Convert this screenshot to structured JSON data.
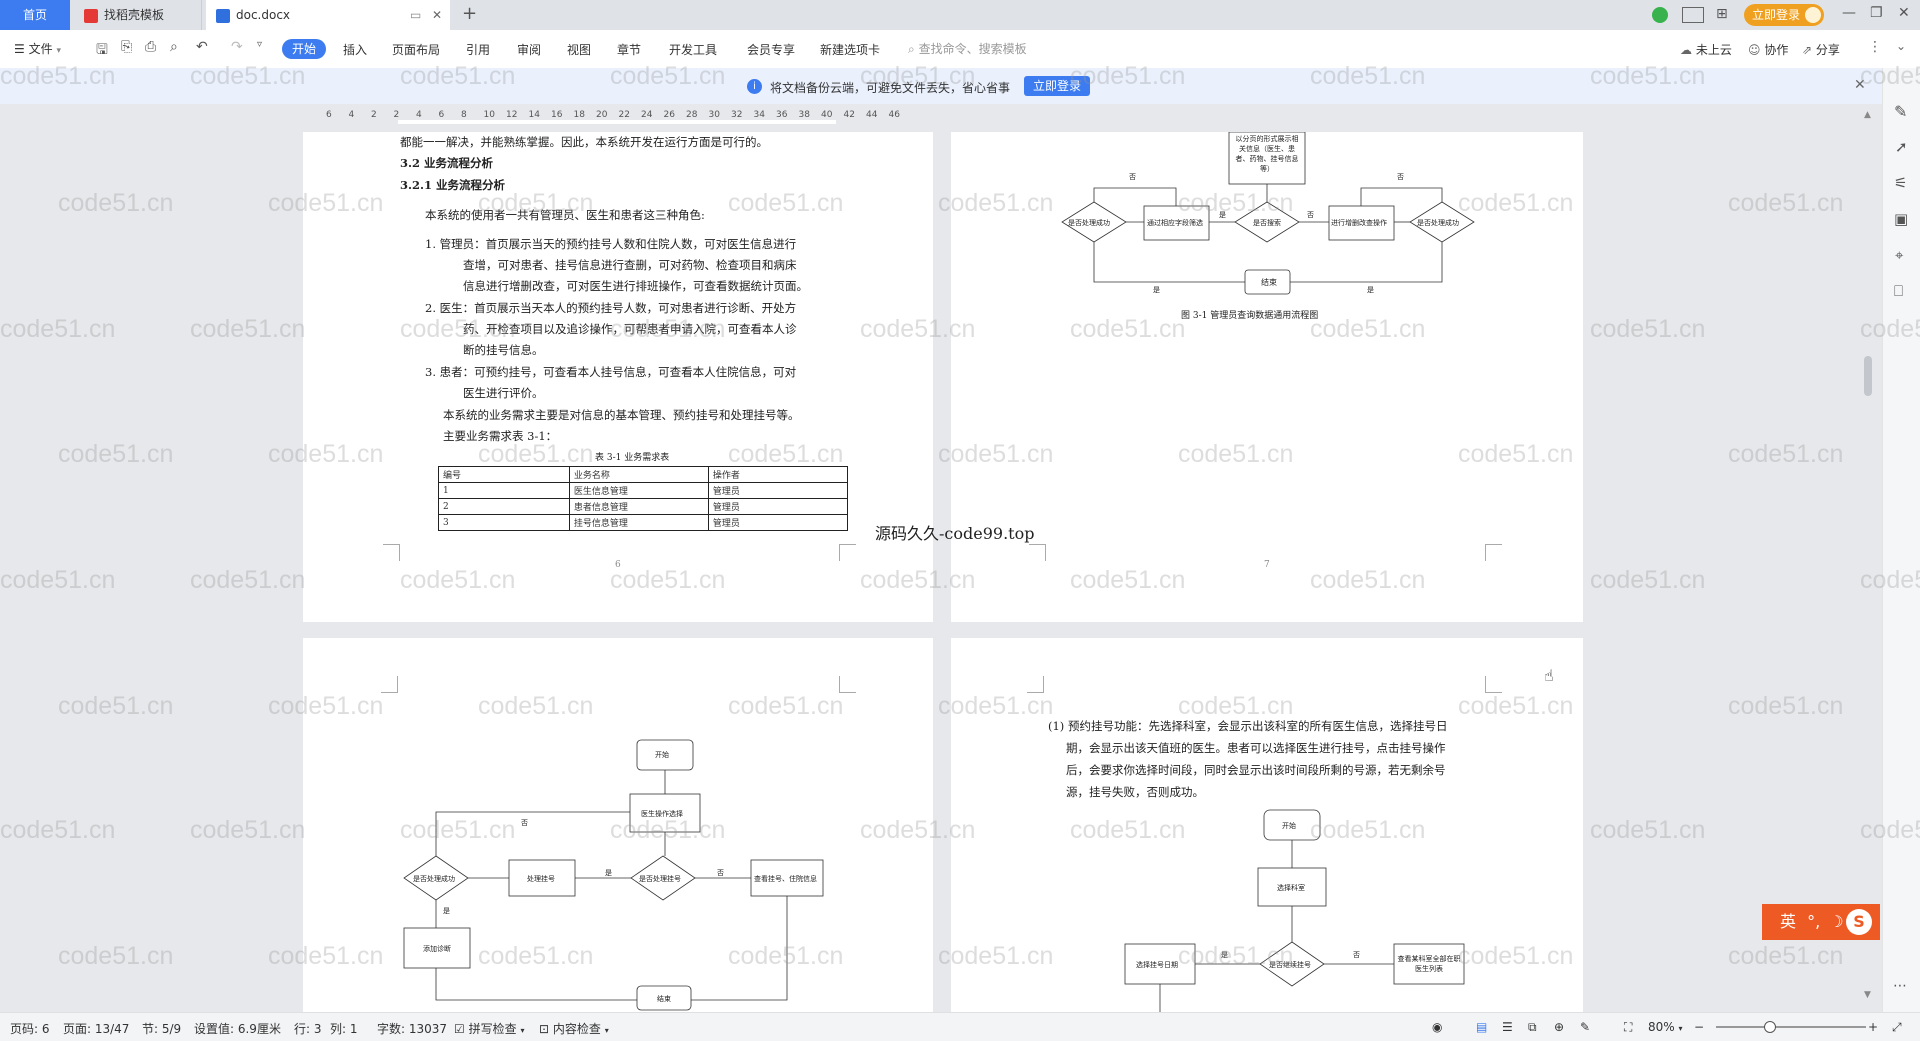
{
  "tabs": {
    "home": "首页",
    "template": "找稻壳模板",
    "doc": "doc.docx",
    "login": "立即登录"
  },
  "toolbar": {
    "file": "文件",
    "menus": [
      "开始",
      "插入",
      "页面布局",
      "引用",
      "审阅",
      "视图",
      "章节",
      "开发工具",
      "会员专享",
      "新建选项卡"
    ],
    "search_placeholder": "查找命令、搜索模板",
    "cloud": "未上云",
    "collab": "协作",
    "share": "分享"
  },
  "notice": {
    "text": "将文档备份云端，可避免文件丢失，省心省事",
    "button": "立即登录"
  },
  "ruler": {
    "ticks": [
      "6",
      "4",
      "2",
      "2",
      "4",
      "6",
      "8",
      "10",
      "12",
      "14",
      "16",
      "18",
      "20",
      "22",
      "24",
      "26",
      "28",
      "30",
      "32",
      "34",
      "36",
      "38",
      "40",
      "42",
      "44",
      "46"
    ]
  },
  "page6": {
    "line0": "都能一一解决，并能熟练掌握。因此，本系统开发在运行方面是可行的。",
    "h1": "3.2 业务流程分析",
    "h2": "3.2.1 业务流程分析",
    "p1": "本系统的使用者一共有管理员、医生和患者这三种角色:",
    "item1_a": "1.  管理员：首页展示当天的预约挂号人数和住院人数，可对医生信息进行",
    "item1_b": "查增，可对患者、挂号信息进行查删，可对药物、检查项目和病床",
    "item1_c": "信息进行增删改查，可对医生进行排班操作，可查看数据统计页面。",
    "item2_a": "2.  医生：首页展示当天本人的预约挂号人数，可对患者进行诊断、开处方",
    "item2_b": "药、开检查项目以及追诊操作，可帮患者申请入院，可查看本人诊",
    "item2_c": "断的挂号信息。",
    "item3_a": "3.  患者：可预约挂号，可查看本人挂号信息，可查看本人住院信息，可对",
    "item3_b": "医生进行评价。",
    "p2": "本系统的业务需求主要是对信息的基本管理、预约挂号和处理挂号等。",
    "p3": "主要业务需求表 3-1：",
    "table_caption": "表 3-1  业务需求表",
    "table_headers": [
      "编号",
      "业务名称",
      "操作者"
    ],
    "table_rows": [
      [
        "1",
        "医生信息管理",
        "管理员"
      ],
      [
        "2",
        "患者信息管理",
        "管理员"
      ],
      [
        "3",
        "挂号信息管理",
        "管理员"
      ]
    ],
    "page_no": "6"
  },
  "overlay_text": "源码久久-code99.top",
  "page7": {
    "top_box": "以分页的形式展示相关信息（医生、患者、药物、挂号信息等）",
    "n_fail1": "是否处理成功",
    "n_filter": "通过相应字段筛选",
    "n_search": "是否搜索",
    "n_crud": "进行增删改查操作",
    "n_fail2": "是否处理成功",
    "n_end": "结束",
    "yes": "是",
    "no": "否",
    "caption": "图 3-1  管理员查询数据通用流程图",
    "page_no": "7"
  },
  "page8": {
    "start": "开始",
    "select": "医生操作选择",
    "handle": "处理挂号",
    "if_handle": "是否处理挂号",
    "view": "查看挂号、住院信息",
    "if_ok": "是否处理成功",
    "add": "添加诊断",
    "end": "结束",
    "yes": "是",
    "no": "否"
  },
  "page9": {
    "l1": "(1) 预约挂号功能：先选择科室，会显示出该科室的所有医生信息，选择挂号日",
    "l2": "期，会显示出该天值班的医生。患者可以选择医生进行挂号，点击挂号操作",
    "l3": "后，会要求你选择时间段，同时会显示出该时间段所剩的号源，若无剩余号",
    "l4": "源，挂号失败，否则成功。",
    "start": "开始",
    "dept": "选择科室",
    "date": "选择挂号日期",
    "cont": "是否继续挂号",
    "all": "查看某科室全部在职医生列表",
    "yes": "是",
    "no": "否"
  },
  "watermark": "code51.cn",
  "ime": "英",
  "status": {
    "page": "页码: 6",
    "pages": "页面: 13/47",
    "section": "节: 5/9",
    "setting": "设置值: 6.9厘米",
    "row": "行: 3",
    "col": "列: 1",
    "words": "字数: 13037",
    "spell": "拼写检查",
    "content": "内容检查",
    "zoom": "80%"
  }
}
